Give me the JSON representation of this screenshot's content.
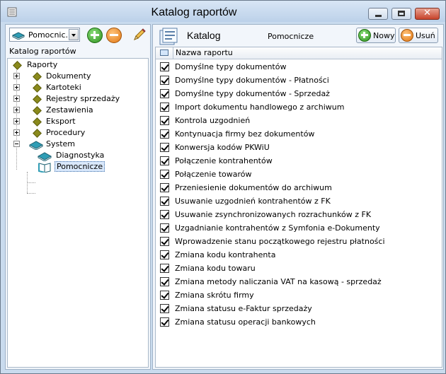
{
  "window": {
    "title": "Katalog raportów"
  },
  "left_panel": {
    "combo_value": "Pomocnic...",
    "label": "Katalog raportów",
    "tree": {
      "root": "Raporty",
      "items": [
        "Dokumenty",
        "Kartoteki",
        "Rejestry sprzedaży",
        "Zestawienia",
        "Eksport",
        "Procedury",
        "System"
      ],
      "system_children": [
        "Diagnostyka",
        "Pomocnicze"
      ],
      "selected": "Pomocnicze"
    }
  },
  "right_panel": {
    "title": "Katalog",
    "subtitle": "Pomocnicze",
    "new_label": "Nowy",
    "delete_label": "Usuń",
    "column_header": "Nazwa raportu",
    "rows": [
      "Domyślne typy dokumentów",
      "Domyślne typy dokumentów - Płatności",
      "Domyślne typy dokumentów - Sprzedaż",
      "Import dokumentu handlowego z archiwum",
      "Kontrola uzgodnień",
      "Kontynuacja firmy bez dokumentów",
      "Konwersja kodów PKWiU",
      "Połączenie kontrahentów",
      "Połączenie towarów",
      "Przeniesienie dokumentów do archiwum",
      "Usuwanie uzgodnień kontrahentów z FK",
      "Usuwanie zsynchronizowanych rozrachunków z FK",
      "Uzgadnianie kontrahentów z Symfonia e-Dokumenty",
      "Wprowadzenie stanu początkowego rejestru płatności",
      "Zmiana kodu kontrahenta",
      "Zmiana kodu towaru",
      "Zmiana metody naliczania VAT na kasową - sprzedaż",
      "Zmiana skrótu firmy",
      "Zmiana statusu e-Faktur sprzedaży",
      "Zmiana statusu operacji bankowych"
    ]
  }
}
